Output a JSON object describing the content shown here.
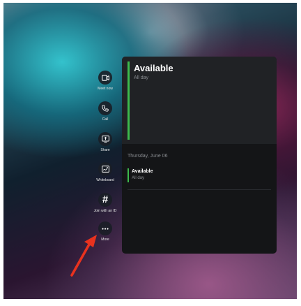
{
  "rail": [
    {
      "id": "meet-now",
      "label": "Meet now",
      "icon": "video-camera-icon"
    },
    {
      "id": "call",
      "label": "Call",
      "icon": "phone-icon"
    },
    {
      "id": "share",
      "label": "Share",
      "icon": "share-screen-icon"
    },
    {
      "id": "whiteboard",
      "label": "Whiteboard",
      "icon": "whiteboard-icon"
    },
    {
      "id": "join-with-id",
      "label": "Join with an ID",
      "icon": "hash-icon",
      "glyph": "#"
    },
    {
      "id": "more",
      "label": "More",
      "icon": "ellipsis-icon"
    }
  ],
  "panel": {
    "current": {
      "title": "Available",
      "subtitle": "All day"
    },
    "day_header": "Thursday, June 06",
    "events": [
      {
        "title": "Available",
        "subtitle": "All day"
      }
    ]
  },
  "colors": {
    "accent": "#3dbb4d",
    "arrow": "#e8321e"
  }
}
